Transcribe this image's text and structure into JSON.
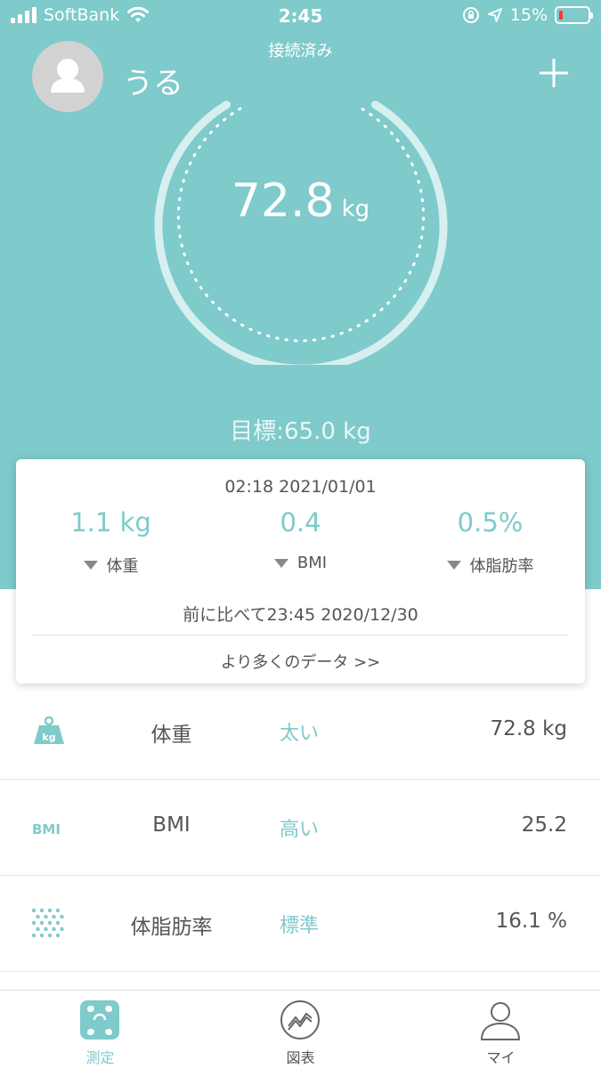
{
  "status_bar": {
    "carrier": "SoftBank",
    "time": "2:45",
    "battery": "15%"
  },
  "connection_status": "接続済み",
  "user": {
    "name": "うる"
  },
  "weight": {
    "value": "72.8",
    "unit": "kg"
  },
  "goal": "目標:65.0 kg",
  "summary_card": {
    "datetime": "02:18 2021/01/01",
    "metrics": [
      {
        "value": "1.1 kg",
        "label": "体重",
        "trend": "down"
      },
      {
        "value": "0.4",
        "label": "BMI",
        "trend": "down"
      },
      {
        "value": "0.5%",
        "label": "体脂肪率",
        "trend": "down"
      }
    ],
    "comparison": "前に比べて23:45 2020/12/30",
    "more_link": "より多くのデータ >>"
  },
  "measurements": [
    {
      "icon": "weight-kg-icon",
      "name": "体重",
      "status": "太い",
      "value": "72.8 kg"
    },
    {
      "icon": "bmi-icon",
      "icon_text": "BMI",
      "name": "BMI",
      "status": "高い",
      "value": "25.2"
    },
    {
      "icon": "body-fat-icon",
      "name": "体脂肪率",
      "status": "標準",
      "value": "16.1 %"
    }
  ],
  "tabs": [
    {
      "label": "測定",
      "icon": "scale-icon",
      "active": true
    },
    {
      "label": "図表",
      "icon": "chart-icon",
      "active": false
    },
    {
      "label": "マイ",
      "icon": "person-icon",
      "active": false
    }
  ],
  "colors": {
    "accent": "#7fcacb",
    "hero_bg": "#7fcacb",
    "battery_low": "#ff3b30"
  }
}
